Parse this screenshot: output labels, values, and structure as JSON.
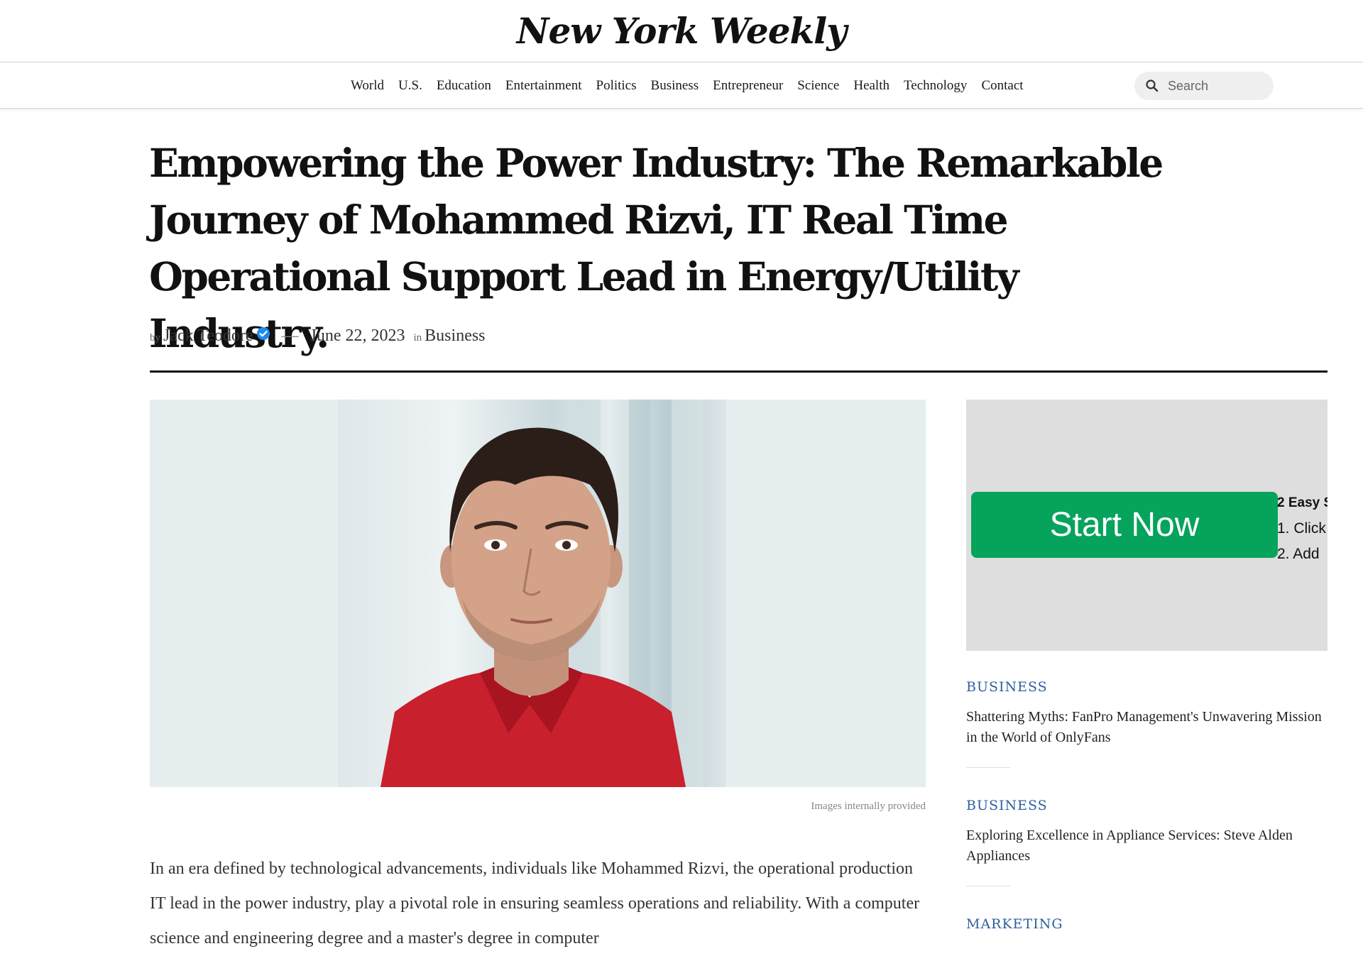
{
  "site": {
    "logo": "New York Weekly"
  },
  "nav": {
    "items": [
      "World",
      "U.S.",
      "Education",
      "Entertainment",
      "Politics",
      "Business",
      "Entrepreneur",
      "Science",
      "Health",
      "Technology",
      "Contact"
    ],
    "search_placeholder": "Search"
  },
  "article": {
    "title": "Empowering the Power Industry: The Remarkable Journey of Mohammed Rizvi, IT Real Time Operational Support Lead in Energy/Utility Industry.",
    "by_label": "by",
    "author": "Jack Teodore",
    "dash": "—",
    "date": "June 22, 2023",
    "in_label": "in",
    "category": "Business",
    "image_caption": "Images internally provided",
    "body": "In an era defined by technological advancements, individuals like Mohammed Rizvi, the operational production IT lead in the power industry, play a pivotal role in ensuring seamless operations and reliability. With a computer science and engineering degree and a master's degree in computer"
  },
  "ad": {
    "button_label": "Start Now",
    "steps_title": "2 Easy S",
    "step1": "1. Click",
    "step2": "2. Add",
    "colors": {
      "button": "#05a35c",
      "background": "#dedede"
    }
  },
  "sidebar": {
    "items": [
      {
        "category": "BUSINESS",
        "title": "Shattering Myths: FanPro Management's Unwavering Mission in the World of OnlyFans"
      },
      {
        "category": "BUSINESS",
        "title": "Exploring Excellence in Appliance Services: Steve Alden Appliances"
      },
      {
        "category": "MARKETING",
        "title": ""
      }
    ]
  },
  "colors": {
    "link": "#2e5f9e",
    "verified": "#1d8cf0",
    "text": "#1a1a1a"
  }
}
